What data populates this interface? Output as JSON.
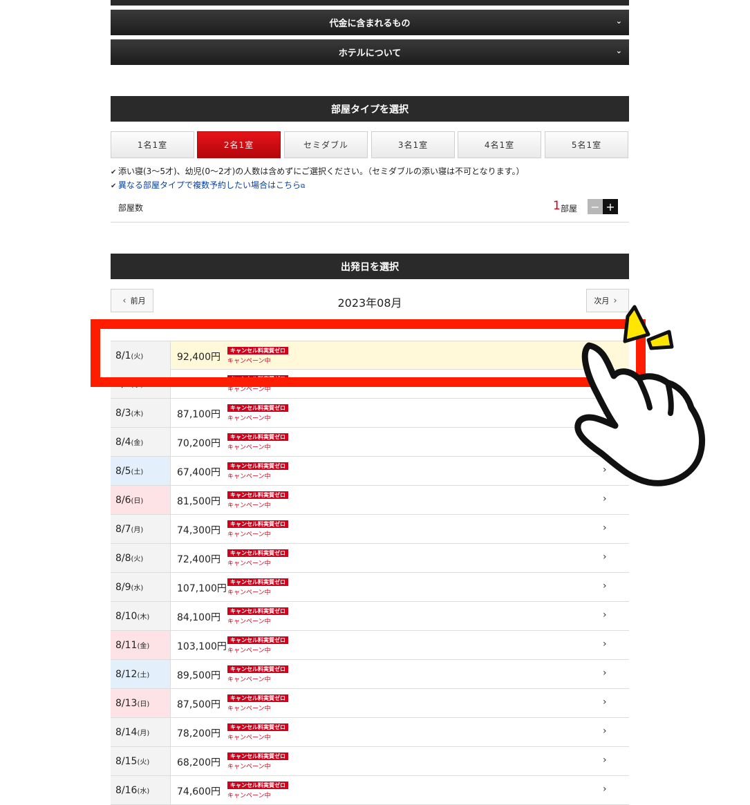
{
  "accordions": [
    {
      "label": "代金に含まれるもの"
    },
    {
      "label": "ホテルについて"
    }
  ],
  "room_type": {
    "heading": "部屋タイプを選択",
    "tabs": [
      {
        "label": "1名1室"
      },
      {
        "label": "2名1室"
      },
      {
        "label": "セミダブル"
      },
      {
        "label": "3名1室"
      },
      {
        "label": "4名1室"
      },
      {
        "label": "5名1室"
      }
    ],
    "selected": "2名1室",
    "note": "添い寝(3〜5才)、幼児(0〜2才)の人数は含めずにご選択ください。（セミダブルの添い寝は不可となります。）",
    "link": "異なる部屋タイプで複数予約したい場合はこちら",
    "rooms_label": "部屋数",
    "rooms_count": "1",
    "rooms_unit": "部屋"
  },
  "departure": {
    "heading": "出発日を選択",
    "prev_label": "前月",
    "next_label": "次月",
    "month_title": "2023年08月",
    "badge_label": "キャンセル料実質ゼロ",
    "campaign_label": "キャンペーン中",
    "dates": [
      {
        "date": "8/1",
        "dow": "(火)",
        "price": "92,400円",
        "type": "weekday",
        "highlight": true
      },
      {
        "date": "8/2",
        "dow": "(水)",
        "price": "",
        "type": "weekday"
      },
      {
        "date": "8/3",
        "dow": "(木)",
        "price": "87,100円",
        "type": "weekday"
      },
      {
        "date": "8/4",
        "dow": "(金)",
        "price": "70,200円",
        "type": "weekday"
      },
      {
        "date": "8/5",
        "dow": "(土)",
        "price": "67,400円",
        "type": "sat"
      },
      {
        "date": "8/6",
        "dow": "(日)",
        "price": "81,500円",
        "type": "sun"
      },
      {
        "date": "8/7",
        "dow": "(月)",
        "price": "74,300円",
        "type": "weekday"
      },
      {
        "date": "8/8",
        "dow": "(火)",
        "price": "72,400円",
        "type": "weekday"
      },
      {
        "date": "8/9",
        "dow": "(水)",
        "price": "107,100円",
        "type": "weekday"
      },
      {
        "date": "8/10",
        "dow": "(木)",
        "price": "84,100円",
        "type": "weekday"
      },
      {
        "date": "8/11",
        "dow": "(金)",
        "price": "103,100円",
        "type": "sun"
      },
      {
        "date": "8/12",
        "dow": "(土)",
        "price": "89,500円",
        "type": "sat"
      },
      {
        "date": "8/13",
        "dow": "(日)",
        "price": "87,500円",
        "type": "sun"
      },
      {
        "date": "8/14",
        "dow": "(月)",
        "price": "78,200円",
        "type": "weekday"
      },
      {
        "date": "8/15",
        "dow": "(火)",
        "price": "68,200円",
        "type": "weekday"
      },
      {
        "date": "8/16",
        "dow": "(水)",
        "price": "74,600円",
        "type": "weekday"
      }
    ]
  },
  "colors": {
    "accent_red": "#d0021b",
    "highlight_frame": "#ff1d00",
    "header_dark": "#2a2a2a",
    "row_highlight": "#fff9d9"
  }
}
